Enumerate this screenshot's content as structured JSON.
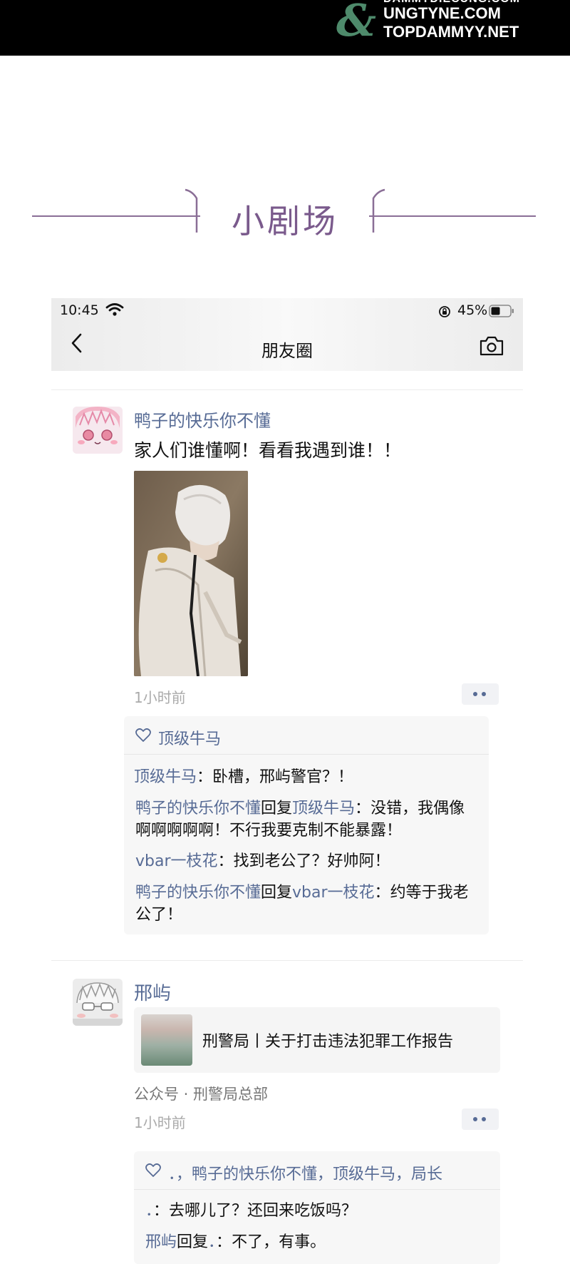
{
  "watermark": {
    "line0": "DAMMYDIECUNG.COM",
    "line1": "UNGTYNE.COM",
    "line2": "TOPDAMMYY.NET"
  },
  "section": {
    "title": "小剧场"
  },
  "status_bar": {
    "time": "10:45",
    "battery": "45%"
  },
  "nav": {
    "title": "朋友圈"
  },
  "posts": [
    {
      "username": "鸭子的快乐你不懂",
      "text": "家人们谁懂啊！看看我遇到谁！！",
      "time": "1小时前",
      "likes": "顶级牛马",
      "comments": [
        {
          "author": "顶级牛马",
          "reply_word": "",
          "target": "",
          "sep": "：",
          "text": "卧槽，邢屿警官？！"
        },
        {
          "author": "鸭子的快乐你不懂",
          "reply_word": "回复",
          "target": "顶级牛马",
          "sep": "：",
          "text": "没错，我偶像啊啊啊啊啊！不行我要克制不能暴露！"
        },
        {
          "author": "vbar一枝花",
          "reply_word": "",
          "target": "",
          "sep": "：",
          "text": "找到老公了？好帅阿！"
        },
        {
          "author": "鸭子的快乐你不懂",
          "reply_word": "回复",
          "target": "vbar一枝花",
          "sep": "：",
          "text": "约等于我老公了！"
        }
      ]
    },
    {
      "username": "邢屿",
      "link_title": "刑警局丨关于打击违法犯罪工作报告",
      "source": "公众号 · 刑警局总部",
      "time": "1小时前",
      "likes": "．，鸭子的快乐你不懂，顶级牛马，局长",
      "comments": [
        {
          "author": "．",
          "reply_word": "",
          "target": "",
          "sep": "：",
          "text": "去哪儿了？还回来吃饭吗？"
        },
        {
          "author": "邢屿",
          "reply_word": "回复",
          "target": "．",
          "sep": "：",
          "text": "不了，有事。"
        }
      ]
    }
  ],
  "colors": {
    "link": "#576b95",
    "accent": "#7a5a8c",
    "watermark_green": "#4e8a6b"
  }
}
